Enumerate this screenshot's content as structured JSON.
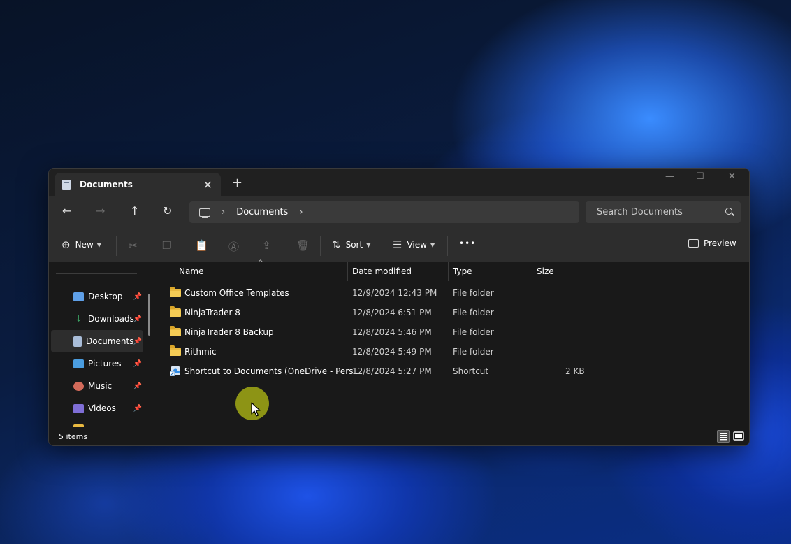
{
  "window": {
    "tab_title": "Documents",
    "new_tab": "+",
    "controls": {
      "minimize": "—",
      "maximize": "☐",
      "close": "✕"
    }
  },
  "nav": {
    "back": "←",
    "forward": "→",
    "up": "↑",
    "refresh": "↻",
    "breadcrumb": [
      "Documents"
    ],
    "search_placeholder": "Search Documents"
  },
  "toolbar": {
    "new_label": "New",
    "sort_label": "Sort",
    "view_label": "View",
    "more_label": "•••",
    "preview_label": "Preview"
  },
  "sidebar": {
    "items": [
      {
        "label": "Desktop",
        "icon": "desktop-icon",
        "color": "#5fa0e8",
        "pinned": true
      },
      {
        "label": "Downloads",
        "icon": "download-icon",
        "color": "#3fae6a",
        "pinned": true
      },
      {
        "label": "Documents",
        "icon": "document-icon",
        "color": "#a9bdd8",
        "pinned": true,
        "active": true
      },
      {
        "label": "Pictures",
        "icon": "pictures-icon",
        "color": "#4a9de0",
        "pinned": true
      },
      {
        "label": "Music",
        "icon": "music-icon",
        "color": "#d26a5a",
        "pinned": true
      },
      {
        "label": "Videos",
        "icon": "videos-icon",
        "color": "#7f6ed6",
        "pinned": true
      }
    ]
  },
  "columns": [
    "Name",
    "Date modified",
    "Type",
    "Size"
  ],
  "files": [
    {
      "name": "Custom Office Templates",
      "date": "12/9/2024 12:43 PM",
      "type": "File folder",
      "size": "",
      "icon": "folder-icon"
    },
    {
      "name": "NinjaTrader 8",
      "date": "12/8/2024 6:51 PM",
      "type": "File folder",
      "size": "",
      "icon": "folder-icon"
    },
    {
      "name": "NinjaTrader 8 Backup",
      "date": "12/8/2024 5:46 PM",
      "type": "File folder",
      "size": "",
      "icon": "folder-icon"
    },
    {
      "name": "Rithmic",
      "date": "12/8/2024 5:49 PM",
      "type": "File folder",
      "size": "",
      "icon": "folder-icon"
    },
    {
      "name": "Shortcut to Documents (OneDrive - Pers...",
      "date": "12/8/2024 5:27 PM",
      "type": "Shortcut",
      "size": "2 KB",
      "icon": "shortcut-icon"
    }
  ],
  "status": {
    "item_count": "5 items"
  },
  "colors": {
    "accent": "#0067c0",
    "folder": "#e9b940",
    "window_bg": "#191919",
    "chrome_bg": "#2d2d2d"
  }
}
